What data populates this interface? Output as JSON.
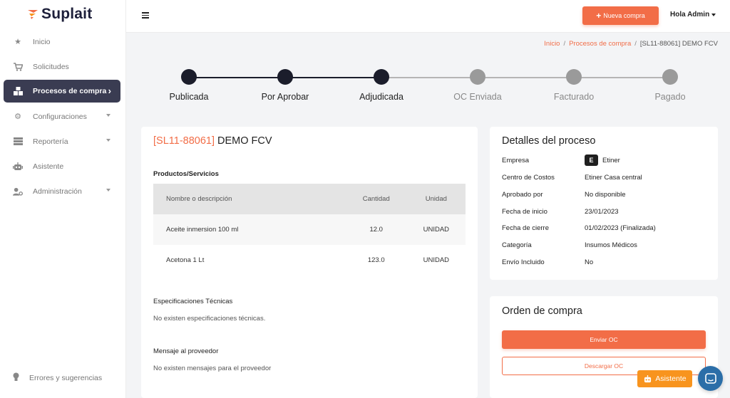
{
  "app": {
    "name": "Suplait"
  },
  "sidebar": {
    "items": [
      {
        "label": "Inicio",
        "icon": "star-icon"
      },
      {
        "label": "Solicitudes",
        "icon": "cart-icon"
      },
      {
        "label": "Procesos de compra",
        "icon": "boxes-icon",
        "active": true
      },
      {
        "label": "Configuraciones",
        "icon": "gear-icon"
      },
      {
        "label": "Reportería",
        "icon": "report-icon"
      },
      {
        "label": "Asistente",
        "icon": "robot-icon"
      },
      {
        "label": "Administración",
        "icon": "user-cog-icon"
      }
    ],
    "footer_label": "Errores y sugerencias"
  },
  "topbar": {
    "new_button_label": "Nueva compra",
    "user_label": "Hola Admin"
  },
  "breadcrumb": {
    "home": "Inicio",
    "section": "Procesos de compra",
    "current": "[SL11-88061] DEMO FCV",
    "separator": "/"
  },
  "stepper": {
    "steps": [
      {
        "label": "Publicada",
        "done": true
      },
      {
        "label": "Por Aprobar",
        "done": true
      },
      {
        "label": "Adjudicada",
        "done": true
      },
      {
        "label": "OC Enviada",
        "done": false
      },
      {
        "label": "Facturado",
        "done": false
      },
      {
        "label": "Pagado",
        "done": false
      }
    ],
    "colors": {
      "done": "#1b1d2b",
      "pending": "#9a9a9a",
      "done_text": "#222222",
      "pending_text": "#888888"
    }
  },
  "process": {
    "code": "[SL11-88061]",
    "name": "DEMO FCV",
    "products_heading": "Productos/Servicios",
    "table": {
      "headers": [
        "Nombre o descripción",
        "Cantidad",
        "Unidad"
      ],
      "rows": [
        [
          "Aceite inmersion 100 ml",
          "12.0",
          "UNIDAD"
        ],
        [
          "Acetona 1 Lt",
          "123.0",
          "UNIDAD"
        ]
      ]
    },
    "specs_heading": "Especificaciones Técnicas",
    "specs_text": "No existen especificaciones técnicas.",
    "message_heading": "Mensaje al proveedor",
    "message_text": "No existen mensajes para el proveedor"
  },
  "details": {
    "title": "Detalles del proceso",
    "rows": [
      {
        "key": "Empresa",
        "value": "Etiner",
        "badge": "E"
      },
      {
        "key": "Centro de Costos",
        "value": "Etiner Casa central"
      },
      {
        "key": "Aprobado por",
        "value": "No disponible"
      },
      {
        "key": "Fecha de inicio",
        "value": "23/01/2023"
      },
      {
        "key": "Fecha de cierre",
        "value": "01/02/2023 (Finalizada)"
      },
      {
        "key": "Categoría",
        "value": "Insumos Médicos"
      },
      {
        "key": "Envío Incluido",
        "value": "No"
      }
    ]
  },
  "purchase_order": {
    "title": "Orden de compra",
    "send_label": "Enviar OC",
    "download_label": "Descargar OC"
  },
  "widgets": {
    "assistant_label": "Asistente"
  },
  "colors": {
    "accent": "#f26d47",
    "sidebar_active": "#3a3c52",
    "assistant": "#f8941e",
    "chat": "#2b6ea8"
  }
}
